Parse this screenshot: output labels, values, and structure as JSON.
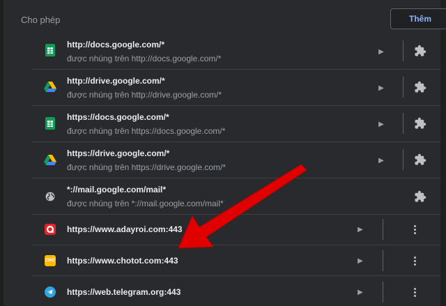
{
  "section": {
    "title": "Cho phép",
    "add_label": "Thêm"
  },
  "sites": [
    {
      "url": "http://docs.google.com/*",
      "embedded": "được nhúng trên http://docs.google.com/*",
      "icon": "google-sheets-icon",
      "trailing": "extension-icon"
    },
    {
      "url": "http://drive.google.com/*",
      "embedded": "được nhúng trên http://drive.google.com/*",
      "icon": "google-drive-icon",
      "trailing": "extension-icon"
    },
    {
      "url": "https://docs.google.com/*",
      "embedded": "được nhúng trên https://docs.google.com/*",
      "icon": "google-sheets-icon",
      "trailing": "extension-icon"
    },
    {
      "url": "https://drive.google.com/*",
      "embedded": "được nhúng trên https://drive.google.com/*",
      "icon": "google-drive-icon",
      "trailing": "extension-icon"
    },
    {
      "url": "*://mail.google.com/mail*",
      "embedded": "được nhúng trên *://mail.google.com/mail*",
      "icon": "globe-icon",
      "trailing": "extension-icon"
    },
    {
      "url": "https://www.adayroi.com:443",
      "icon": "adayroi-icon",
      "trailing": "more-icon"
    },
    {
      "url": "https://www.chotot.com:443",
      "icon": "chotot-icon",
      "icon_text": "CHỢ",
      "trailing": "more-icon"
    },
    {
      "url": "https://web.telegram.org:443",
      "icon": "telegram-icon",
      "trailing": "more-icon"
    }
  ],
  "colors": {
    "background": "#292a2d",
    "accent": "#8ab4f8",
    "arrow": "#e00000"
  }
}
